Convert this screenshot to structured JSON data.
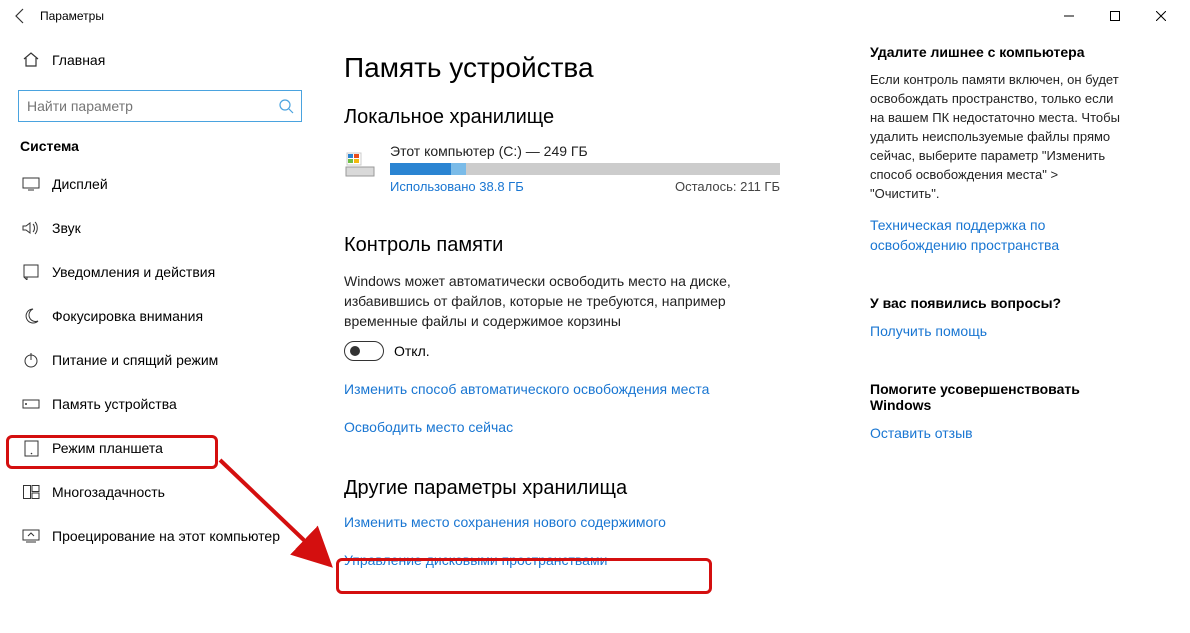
{
  "window": {
    "title": "Параметры"
  },
  "sidebar": {
    "home": "Главная",
    "search_placeholder": "Найти параметр",
    "group": "Система",
    "items": [
      {
        "label": "Дисплей"
      },
      {
        "label": "Звук"
      },
      {
        "label": "Уведомления и действия"
      },
      {
        "label": "Фокусировка внимания"
      },
      {
        "label": "Питание и спящий режим"
      },
      {
        "label": "Память устройства"
      },
      {
        "label": "Режим планшета"
      },
      {
        "label": "Многозадачность"
      },
      {
        "label": "Проецирование на этот компьютер"
      }
    ]
  },
  "main": {
    "title": "Память устройства",
    "local_title": "Локальное хранилище",
    "drive": {
      "name": "Этот компьютер (C:) — 249 ГБ",
      "used_text": "Использовано 38.8 ГБ",
      "remain_text": "Осталось: 211 ГБ",
      "used_pct": 15.6,
      "light_pct": 4
    },
    "sense_title": "Контроль памяти",
    "sense_desc": "Windows может автоматически освободить место на диске, избавившись от файлов, которые не требуются, например временные файлы и содержимое корзины",
    "toggle_state": "Откл.",
    "link_change_auto": "Изменить способ автоматического освобождения места",
    "link_free_now": "Освободить место сейчас",
    "other_title": "Другие параметры хранилища",
    "link_change_loc": "Изменить место сохранения нового содержимого",
    "link_manage_spaces": "Управление дисковыми пространствами"
  },
  "aside": {
    "clean_title": "Удалите лишнее с компьютера",
    "clean_body": "Если контроль памяти включен, он будет освобождать пространство, только если на вашем ПК недостаточно места. Чтобы удалить неиспользуемые файлы прямо сейчас, выберите параметр \"Изменить способ освобождения места\" > \"Очистить\".",
    "support_link": "Техническая поддержка по освобождению пространства",
    "q_title": "У вас появились вопросы?",
    "help_link": "Получить помощь",
    "fb_title": "Помогите усовершенствовать Windows",
    "fb_link": "Оставить отзыв"
  }
}
